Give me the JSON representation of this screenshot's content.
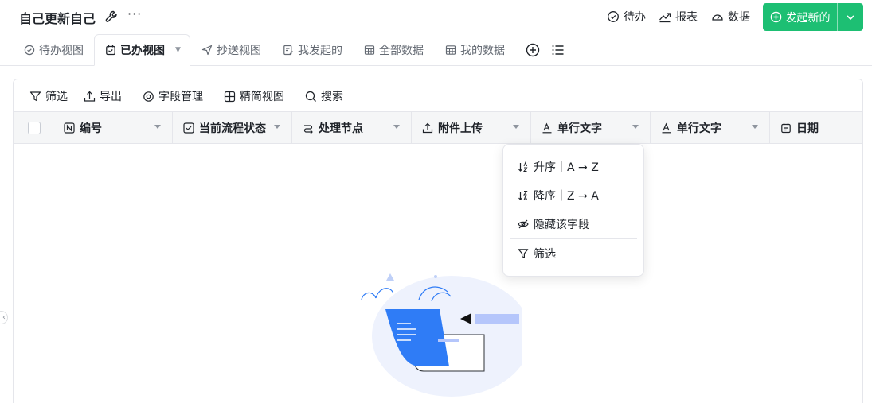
{
  "header": {
    "title": "自己更新自己",
    "more_label": "···",
    "actions": {
      "todo": "待办",
      "report": "报表",
      "data": "数据"
    },
    "primary_button": "发起新的"
  },
  "tabs": [
    {
      "label": "待办视图"
    },
    {
      "label": "已办视图"
    },
    {
      "label": "抄送视图"
    },
    {
      "label": "我发起的"
    },
    {
      "label": "全部数据"
    },
    {
      "label": "我的数据"
    }
  ],
  "toolbar": {
    "filter": "筛选",
    "export": "导出",
    "fields": "字段管理",
    "compact": "精简视图",
    "search": "搜索"
  },
  "columns": [
    {
      "label": "编号",
      "icon": "number-field-icon"
    },
    {
      "label": "当前流程状态",
      "icon": "status-field-icon"
    },
    {
      "label": "处理节点",
      "icon": "flow-node-icon"
    },
    {
      "label": "附件上传",
      "icon": "upload-icon"
    },
    {
      "label": "单行文字",
      "icon": "text-field-icon"
    },
    {
      "label": "单行文字",
      "icon": "text-field-icon"
    },
    {
      "label": "日期",
      "icon": "date-icon"
    }
  ],
  "menu": {
    "sort_asc": "升序｜A → Z",
    "sort_desc": "降序｜Z → A",
    "hide": "隐藏该字段",
    "filter": "筛选"
  },
  "colors": {
    "primary": "#1dbf73",
    "illustration_blue": "#2f7cf6"
  }
}
